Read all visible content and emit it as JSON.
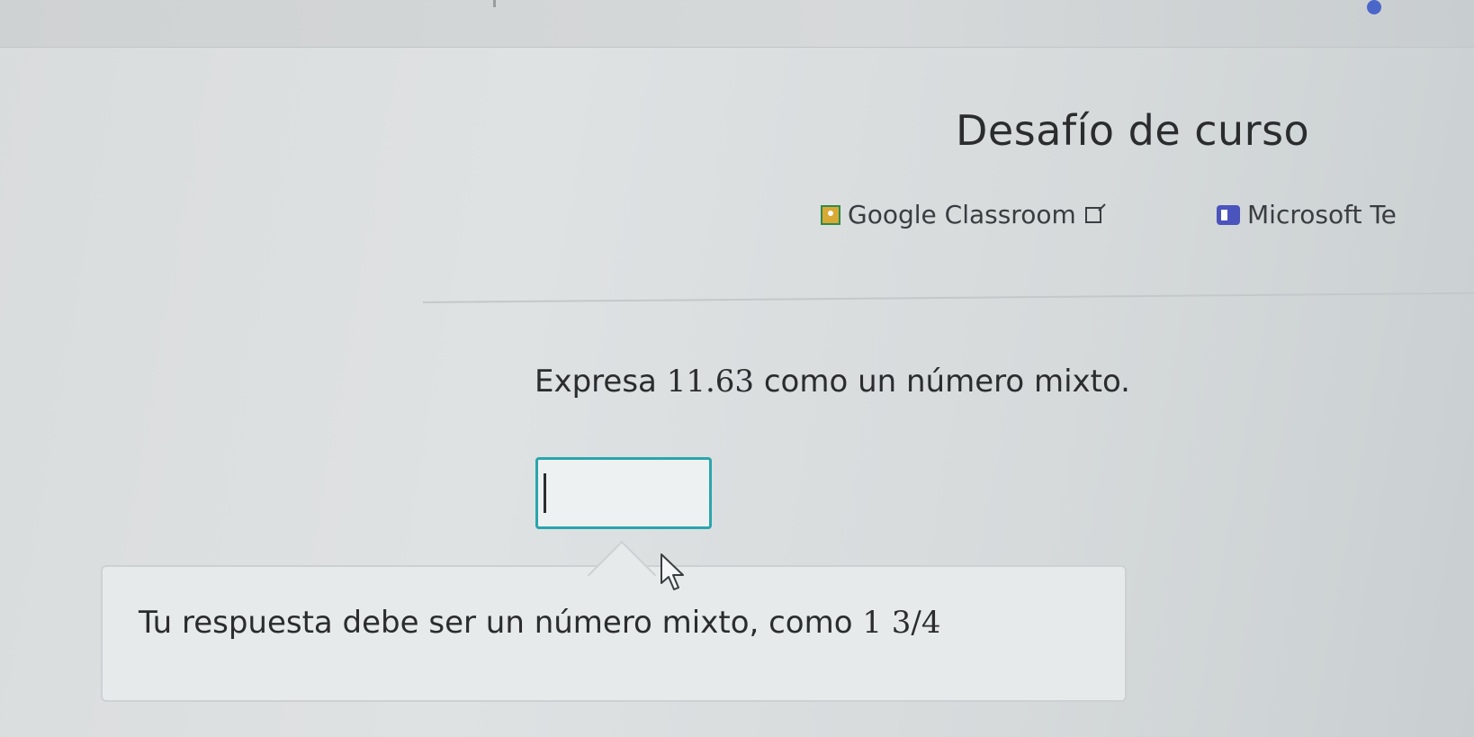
{
  "page": {
    "title": "Desafío de curso"
  },
  "share": {
    "google_classroom_label": "Google Classroom",
    "microsoft_teams_label": "Microsoft Te"
  },
  "question": {
    "prefix": "Expresa ",
    "number": "11.63",
    "suffix": " como un número mixto."
  },
  "answer": {
    "value": ""
  },
  "hint": {
    "prefix": "Tu respuesta debe ser un número mixto, como ",
    "example": "1 3/4"
  },
  "colors": {
    "input_border": "#2aa5ad",
    "teams_icon": "#4b53bc",
    "classroom_icon": "#d8a935",
    "top_dot": "#4a66c9"
  },
  "icons": {
    "classroom": "google-classroom-icon",
    "external": "external-link-icon",
    "teams": "microsoft-teams-icon",
    "cursor": "mouse-pointer-icon"
  }
}
